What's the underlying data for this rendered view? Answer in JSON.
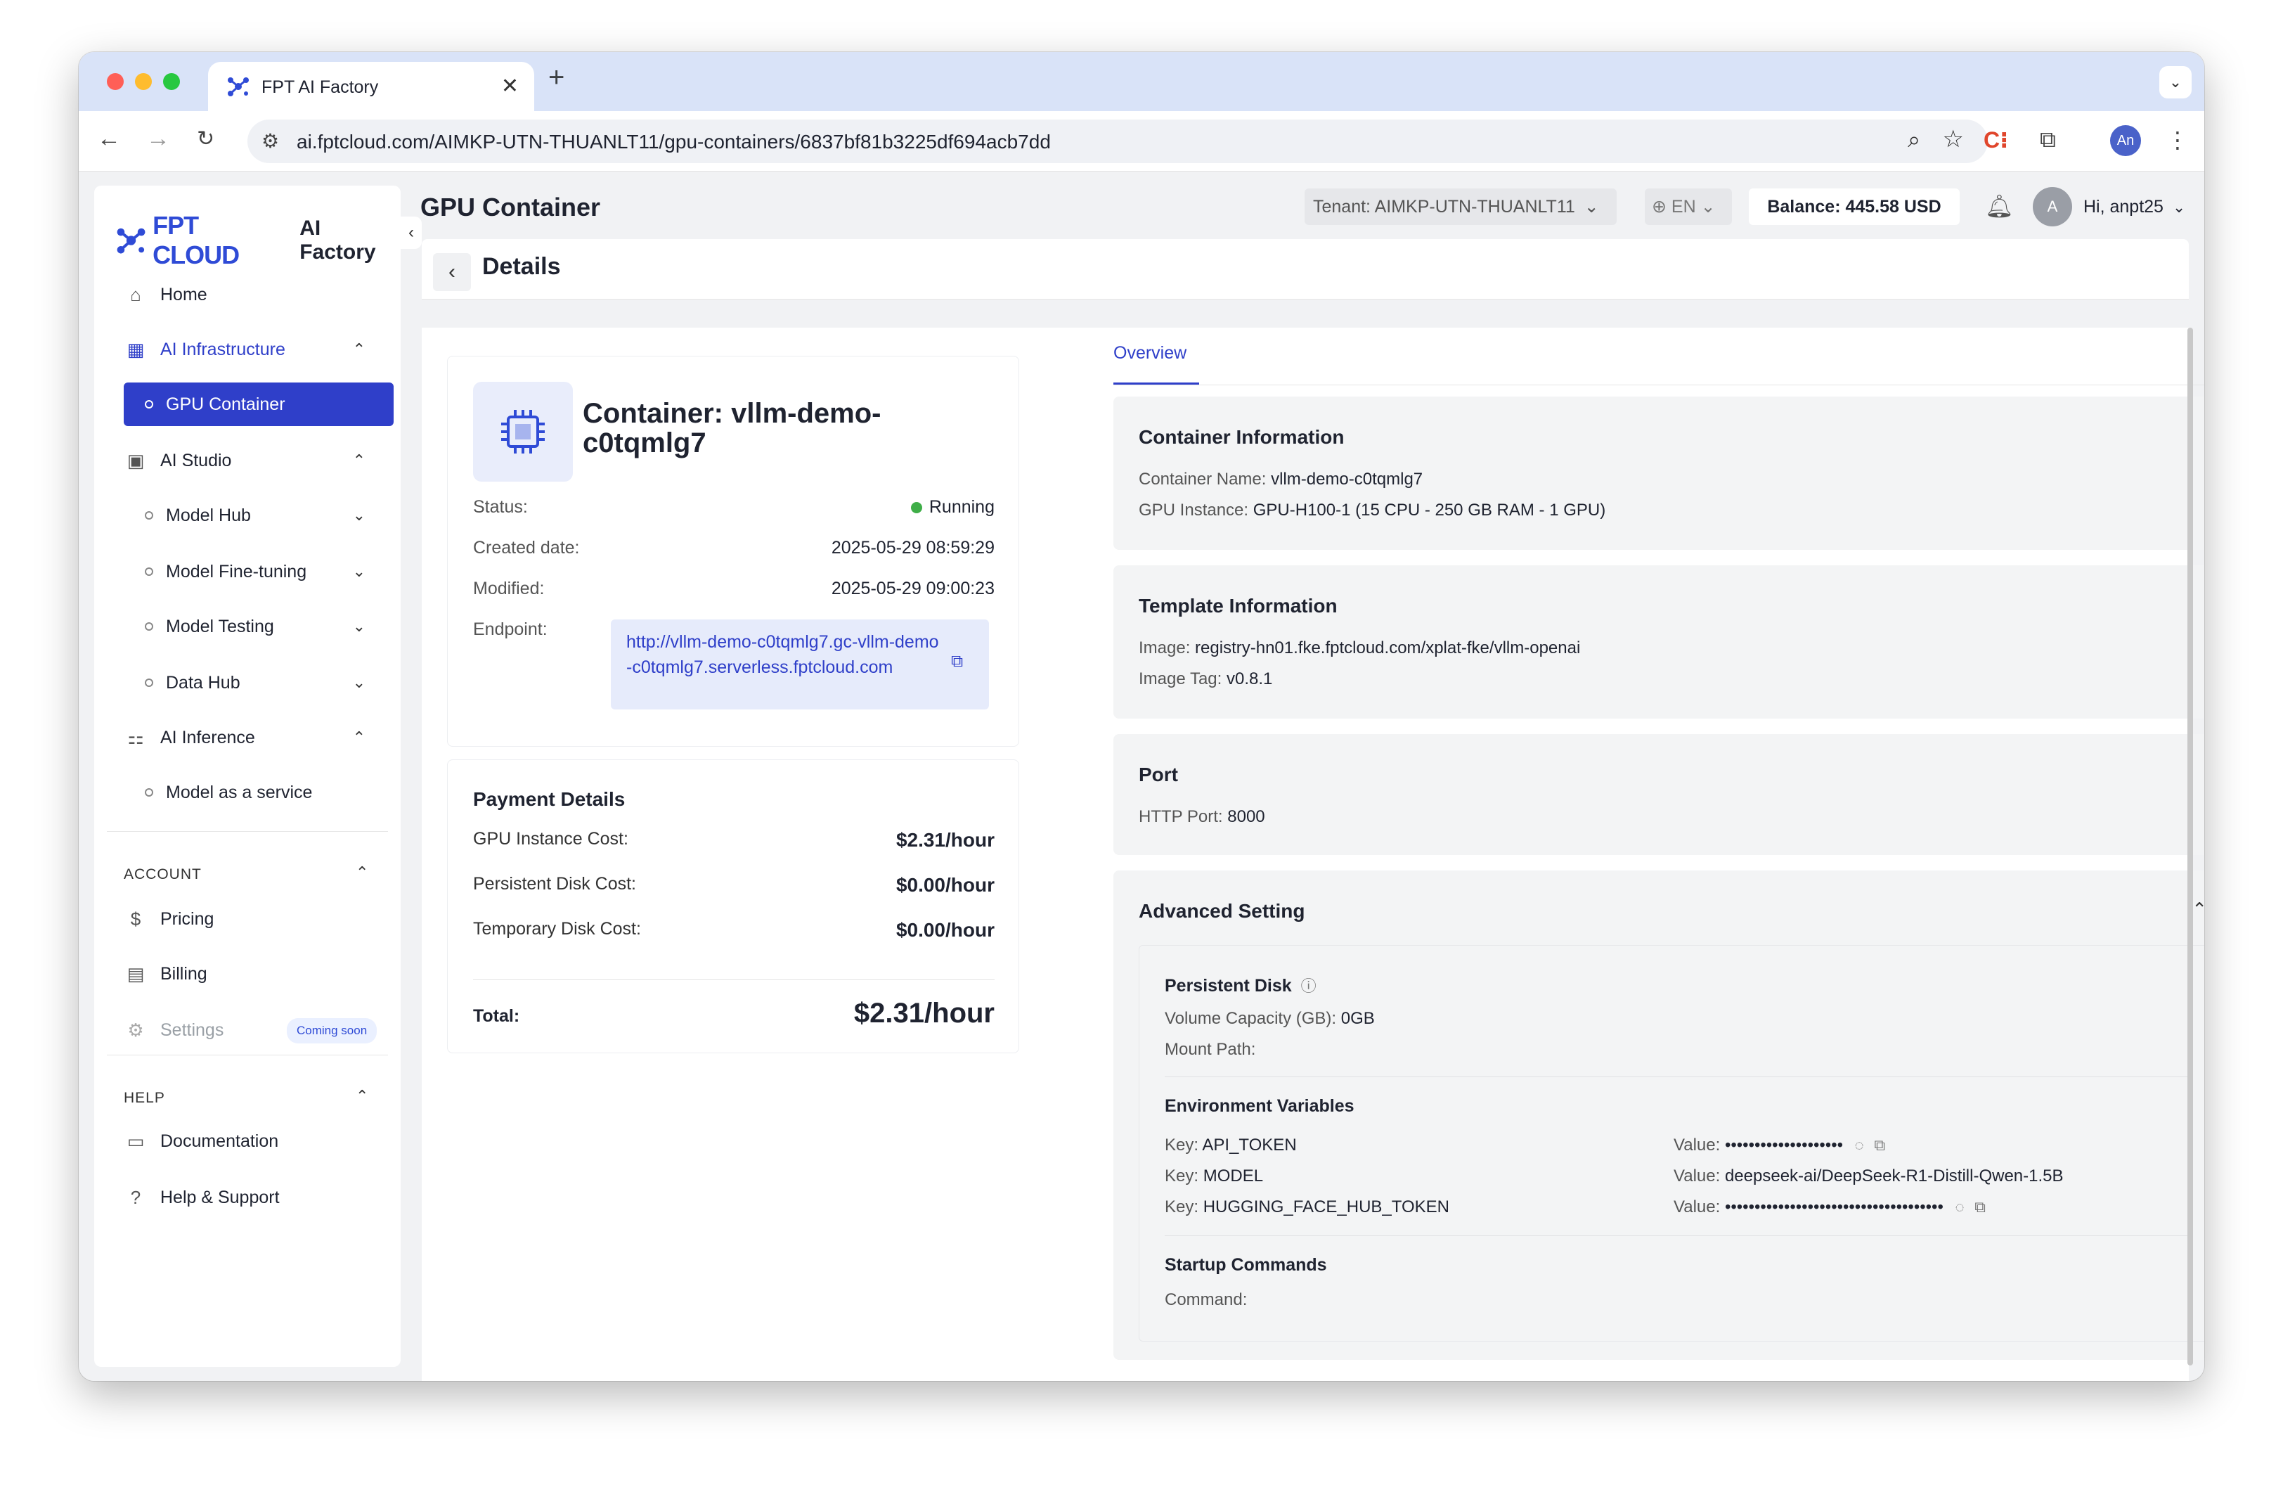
{
  "browser": {
    "tab_title": "FPT AI Factory",
    "url": "ai.fptcloud.com/AIMKP-UTN-THUANLT11/gpu-containers/6837bf81b3225df694acb7dd",
    "profile_initials": "An"
  },
  "sidebar": {
    "brand": "FPT CLOUD",
    "product": "AI Factory",
    "items": {
      "home": "Home",
      "ai_infrastructure": "AI Infrastructure",
      "gpu_container": "GPU Container",
      "ai_studio": "AI Studio",
      "model_hub": "Model Hub",
      "model_finetuning": "Model Fine-tuning",
      "model_testing": "Model Testing",
      "data_hub": "Data Hub",
      "ai_inference": "AI Inference",
      "model_as_service": "Model as a service"
    },
    "account_section": "ACCOUNT",
    "pricing": "Pricing",
    "billing": "Billing",
    "settings": "Settings",
    "coming_soon": "Coming soon",
    "help_section": "HELP",
    "documentation": "Documentation",
    "help_support": "Help & Support"
  },
  "header": {
    "title": "GPU Container",
    "tenant": "Tenant: AIMKP-UTN-THUANLT11",
    "language": "EN",
    "balance": "Balance: 445.58 USD",
    "user_initial": "A",
    "greeting": "Hi, anpt25"
  },
  "details": {
    "title": "Details",
    "container_title": "Container: vllm-demo-c0tqmlg7",
    "status_label": "Status:",
    "status_value": "Running",
    "created_label": "Created date:",
    "created_value": "2025-05-29 08:59:29",
    "modified_label": "Modified:",
    "modified_value": "2025-05-29 09:00:23",
    "endpoint_label": "Endpoint:",
    "endpoint_value": "http://vllm-demo-c0tqmlg7.gc-vllm-demo-c0tqmlg7.serverless.fptcloud.com"
  },
  "payment": {
    "title": "Payment Details",
    "gpu_label": "GPU Instance Cost:",
    "gpu_value": "$2.31/hour",
    "persistent_label": "Persistent Disk Cost:",
    "persistent_value": "$0.00/hour",
    "temporary_label": "Temporary Disk Cost:",
    "temporary_value": "$0.00/hour",
    "total_label": "Total:",
    "total_value": "$2.31/hour"
  },
  "overview": {
    "tab": "Overview",
    "container_info": {
      "title": "Container Information",
      "name_label": "Container Name:",
      "name_value": "vllm-demo-c0tqmlg7",
      "gpu_label": "GPU Instance:",
      "gpu_value": "GPU-H100-1 (15 CPU - 250 GB RAM - 1 GPU)"
    },
    "template_info": {
      "title": "Template Information",
      "image_label": "Image:",
      "image_value": "registry-hn01.fke.fptcloud.com/xplat-fke/vllm-openai",
      "tag_label": "Image Tag:",
      "tag_value": "v0.8.1"
    },
    "port": {
      "title": "Port",
      "http_label": "HTTP Port:",
      "http_value": "8000"
    },
    "advanced": {
      "title": "Advanced Setting",
      "persistent_disk": "Persistent Disk",
      "capacity_label": "Volume Capacity (GB):",
      "capacity_value": "0GB",
      "mount_label": "Mount Path:",
      "env_title": "Environment Variables",
      "env": [
        {
          "key_label": "Key:",
          "key": "API_TOKEN",
          "value_label": "Value:",
          "value": "••••••••••••••••••••"
        },
        {
          "key_label": "Key:",
          "key": "MODEL",
          "value_label": "Value:",
          "value": "deepseek-ai/DeepSeek-R1-Distill-Qwen-1.5B"
        },
        {
          "key_label": "Key:",
          "key": "HUGGING_FACE_HUB_TOKEN",
          "value_label": "Value:",
          "value": "•••••••••••••••••••••••••••••••••••••"
        }
      ],
      "startup_title": "Startup Commands",
      "command_label": "Command:"
    }
  }
}
